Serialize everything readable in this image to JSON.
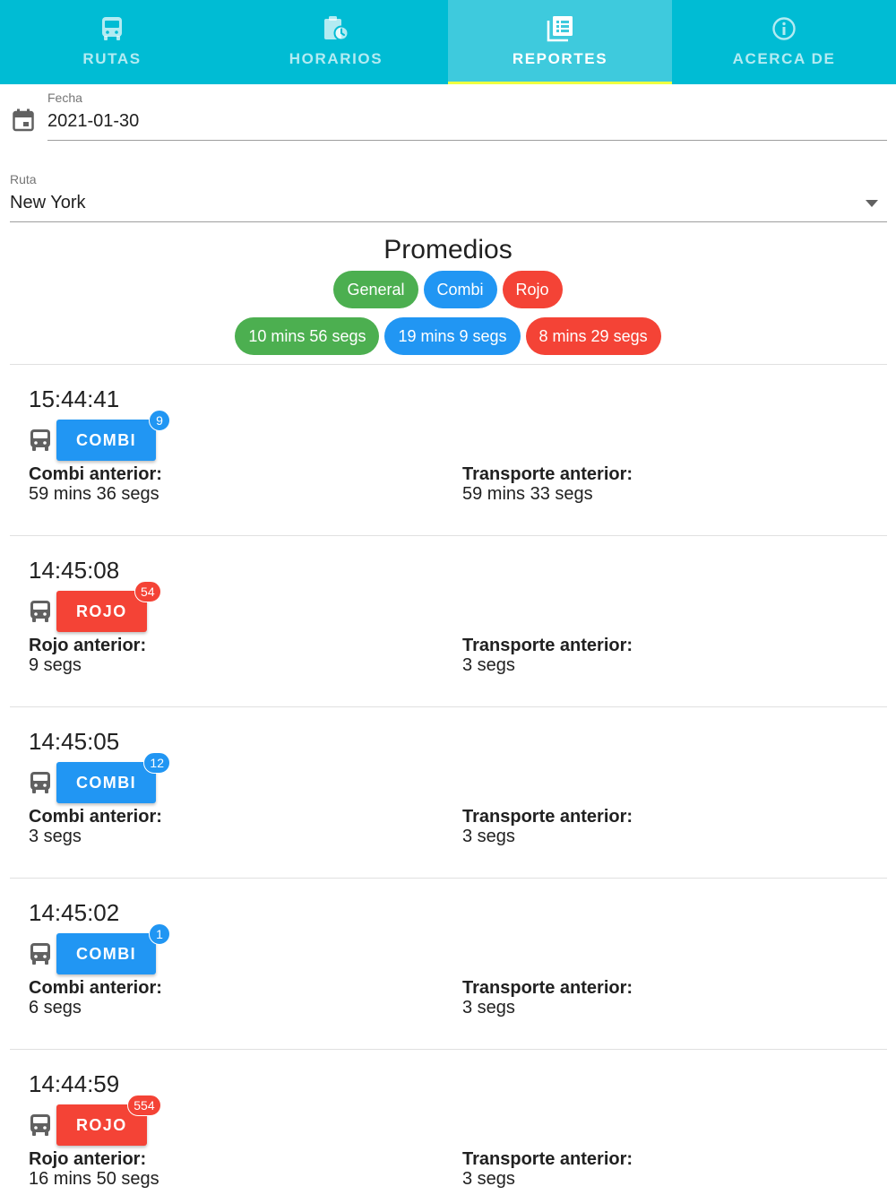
{
  "colors": {
    "tab_bg": "#00BCD4",
    "tab_active_bg": "#3ECADD",
    "indicator": "#EEFF41",
    "green": "#4CAF50",
    "blue": "#2196F3",
    "red": "#F44336"
  },
  "tabs": [
    {
      "label": "RUTAS",
      "icon": "bus-icon"
    },
    {
      "label": "HORARIOS",
      "icon": "clipboard-clock-icon"
    },
    {
      "label": "REPORTES",
      "icon": "report-list-icon",
      "active": true
    },
    {
      "label": "ACERCA DE",
      "icon": "info-icon"
    }
  ],
  "fecha": {
    "label": "Fecha",
    "value": "2021-01-30",
    "icon": "calendar-icon"
  },
  "ruta": {
    "label": "Ruta",
    "value": "New York",
    "icon": "dropdown-arrow-icon"
  },
  "promedios": {
    "title": "Promedios",
    "categories": [
      {
        "label": "General",
        "color": "#4CAF50"
      },
      {
        "label": "Combi",
        "color": "#2196F3"
      },
      {
        "label": "Rojo",
        "color": "#F44336"
      }
    ],
    "values": [
      {
        "label": "10 mins 56 segs",
        "color": "#4CAF50"
      },
      {
        "label": "19 mins 9 segs",
        "color": "#2196F3"
      },
      {
        "label": "8 mins 29 segs",
        "color": "#F44336"
      }
    ]
  },
  "entries": [
    {
      "time": "15:44:41",
      "type": "COMBI",
      "badge": "9",
      "prev_label": "Combi anterior:",
      "prev_value": "59 mins 36 segs",
      "transport_label": "Transporte anterior:",
      "transport_value": "59 mins 33 segs"
    },
    {
      "time": "14:45:08",
      "type": "ROJO",
      "badge": "54",
      "prev_label": "Rojo anterior:",
      "prev_value": "9 segs",
      "transport_label": "Transporte anterior:",
      "transport_value": "3 segs"
    },
    {
      "time": "14:45:05",
      "type": "COMBI",
      "badge": "12",
      "prev_label": "Combi anterior:",
      "prev_value": "3 segs",
      "transport_label": "Transporte anterior:",
      "transport_value": "3 segs"
    },
    {
      "time": "14:45:02",
      "type": "COMBI",
      "badge": "1",
      "prev_label": "Combi anterior:",
      "prev_value": "6 segs",
      "transport_label": "Transporte anterior:",
      "transport_value": "3 segs"
    },
    {
      "time": "14:44:59",
      "type": "ROJO",
      "badge": "554",
      "prev_label": "Rojo anterior:",
      "prev_value": "16 mins 50 segs",
      "transport_label": "Transporte anterior:",
      "transport_value": "3 segs"
    }
  ]
}
